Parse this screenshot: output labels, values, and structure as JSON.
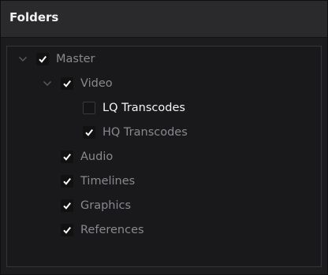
{
  "panel": {
    "title": "Folders"
  },
  "tree": {
    "items": [
      {
        "label": "Master",
        "checked": true,
        "expanded": true
      },
      {
        "label": "Video",
        "checked": true,
        "expanded": true
      },
      {
        "label": "LQ Transcodes",
        "checked": false,
        "highlighted": true
      },
      {
        "label": "HQ Transcodes",
        "checked": true
      },
      {
        "label": "Audio",
        "checked": true
      },
      {
        "label": "Timelines",
        "checked": true
      },
      {
        "label": "Graphics",
        "checked": true
      },
      {
        "label": "References",
        "checked": true
      }
    ]
  },
  "colors": {
    "panel_background": "#1c1c1e",
    "header_background": "#2a2a2d",
    "text_dim": "#8a8a8e",
    "text_bright": "#f4f4f4",
    "checkmark": "#ffffff"
  }
}
